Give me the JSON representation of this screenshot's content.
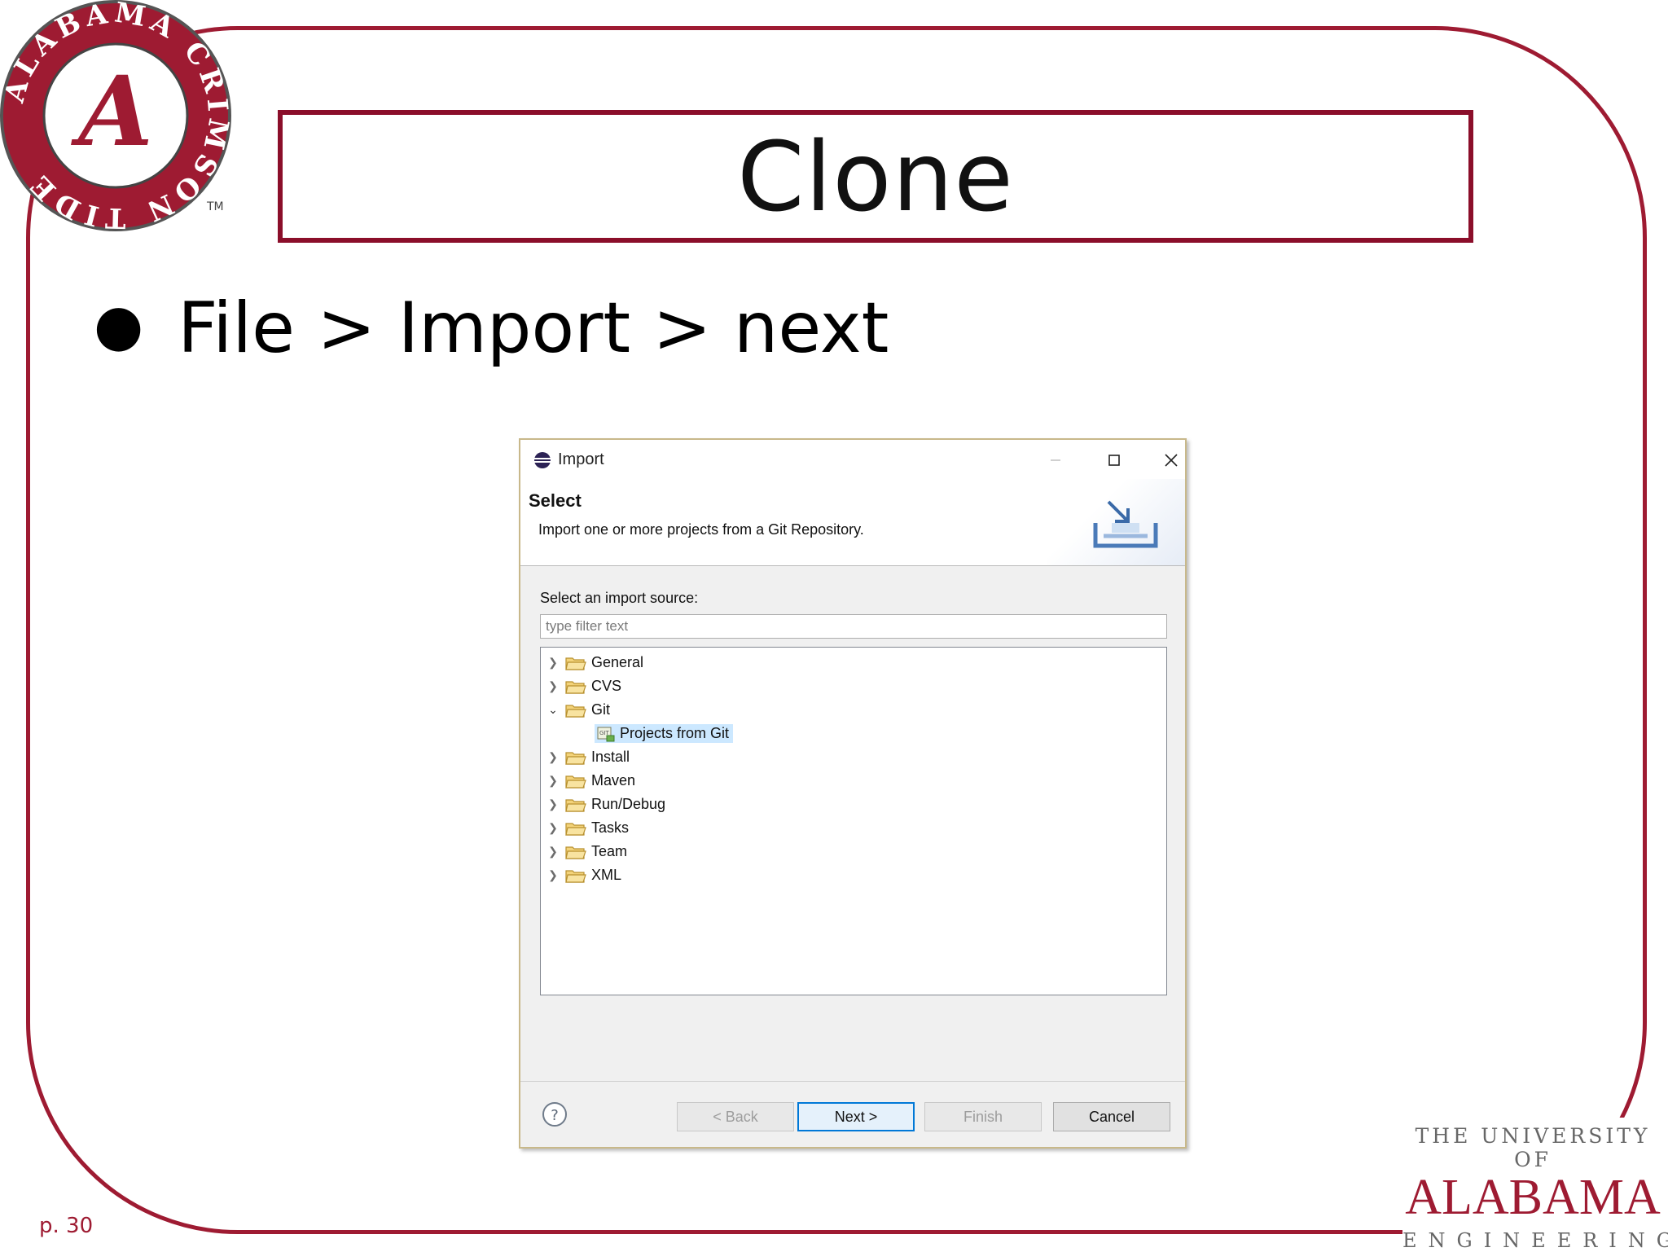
{
  "slide": {
    "title": "Clone",
    "bullet": "File > Import > next",
    "page_number": "p. 30"
  },
  "logo": {
    "ring_text": "ALABAMA CRIMSON TIDE",
    "letter": "A",
    "trademark": "TM"
  },
  "branding": {
    "line1": "THE UNIVERSITY OF",
    "line2": "ALABAMA",
    "line3": "ENGINEERING"
  },
  "dialog": {
    "title": "Import",
    "header_title": "Select",
    "header_description": "Import one or more projects from a Git Repository.",
    "source_label": "Select an import source:",
    "filter_placeholder": "type filter text",
    "tree": [
      {
        "label": "General",
        "expanded": false
      },
      {
        "label": "CVS",
        "expanded": false
      },
      {
        "label": "Git",
        "expanded": true,
        "children": [
          {
            "label": "Projects from Git",
            "selected": true
          }
        ]
      },
      {
        "label": "Install",
        "expanded": false
      },
      {
        "label": "Maven",
        "expanded": false
      },
      {
        "label": "Run/Debug",
        "expanded": false
      },
      {
        "label": "Tasks",
        "expanded": false
      },
      {
        "label": "Team",
        "expanded": false
      },
      {
        "label": "XML",
        "expanded": false
      }
    ],
    "buttons": {
      "back": "< Back",
      "next": "Next >",
      "finish": "Finish",
      "cancel": "Cancel"
    }
  },
  "colors": {
    "crimson": "#9e1b32",
    "selection": "#cce8ff",
    "default_button_border": "#0078d7"
  }
}
